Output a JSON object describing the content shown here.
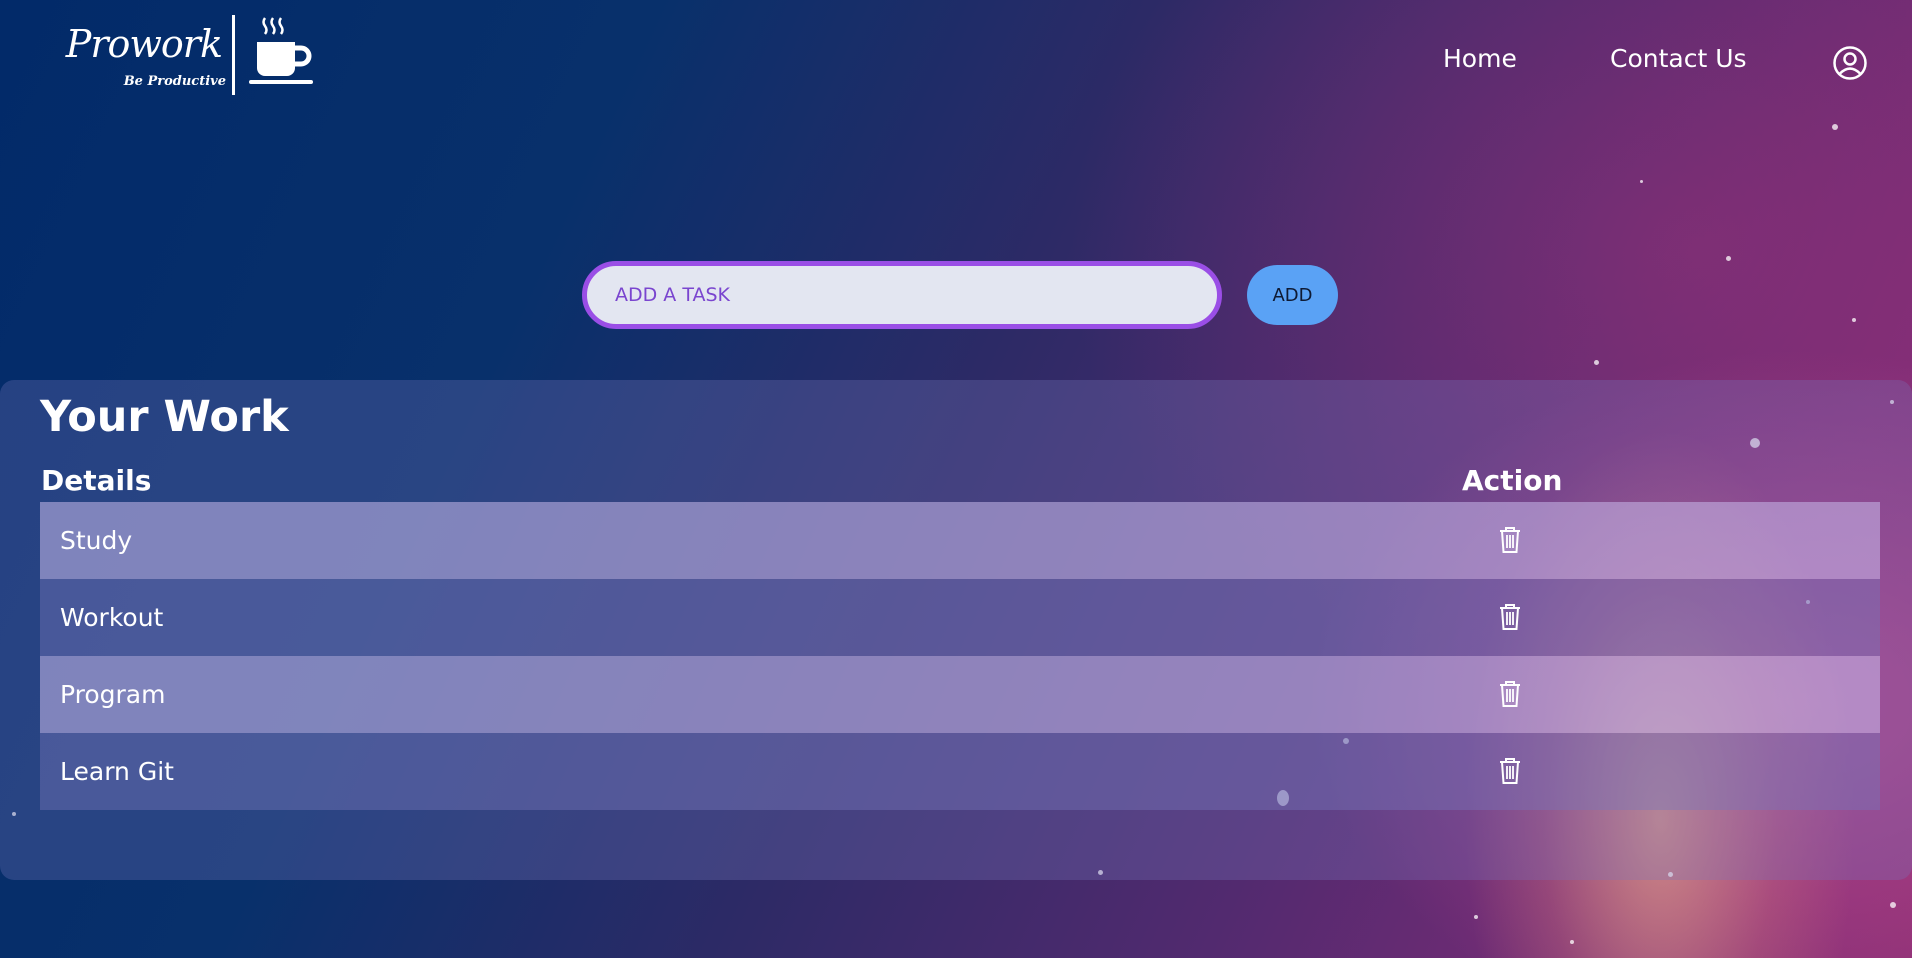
{
  "header": {
    "logo": {
      "name": "Prowork",
      "tagline": "Be Productive",
      "icon": "coffee-cup-icon"
    },
    "nav": [
      {
        "label": "Home"
      },
      {
        "label": "Contact Us"
      }
    ],
    "user_icon": "user-circle-icon"
  },
  "add_task": {
    "placeholder": "ADD A TASK",
    "value": "",
    "button_label": "ADD"
  },
  "work": {
    "title": "Your Work",
    "columns": {
      "details": "Details",
      "action": "Action"
    },
    "tasks": [
      {
        "label": "Study",
        "action_icon": "trash-icon"
      },
      {
        "label": "Workout",
        "action_icon": "trash-icon"
      },
      {
        "label": "Program",
        "action_icon": "trash-icon"
      },
      {
        "label": "Learn Git",
        "action_icon": "trash-icon"
      }
    ]
  },
  "colors": {
    "input_border": "#9a4ee6",
    "add_button": "#5aa2f5",
    "background_start": "#022a69",
    "background_end": "#8a2f74"
  }
}
